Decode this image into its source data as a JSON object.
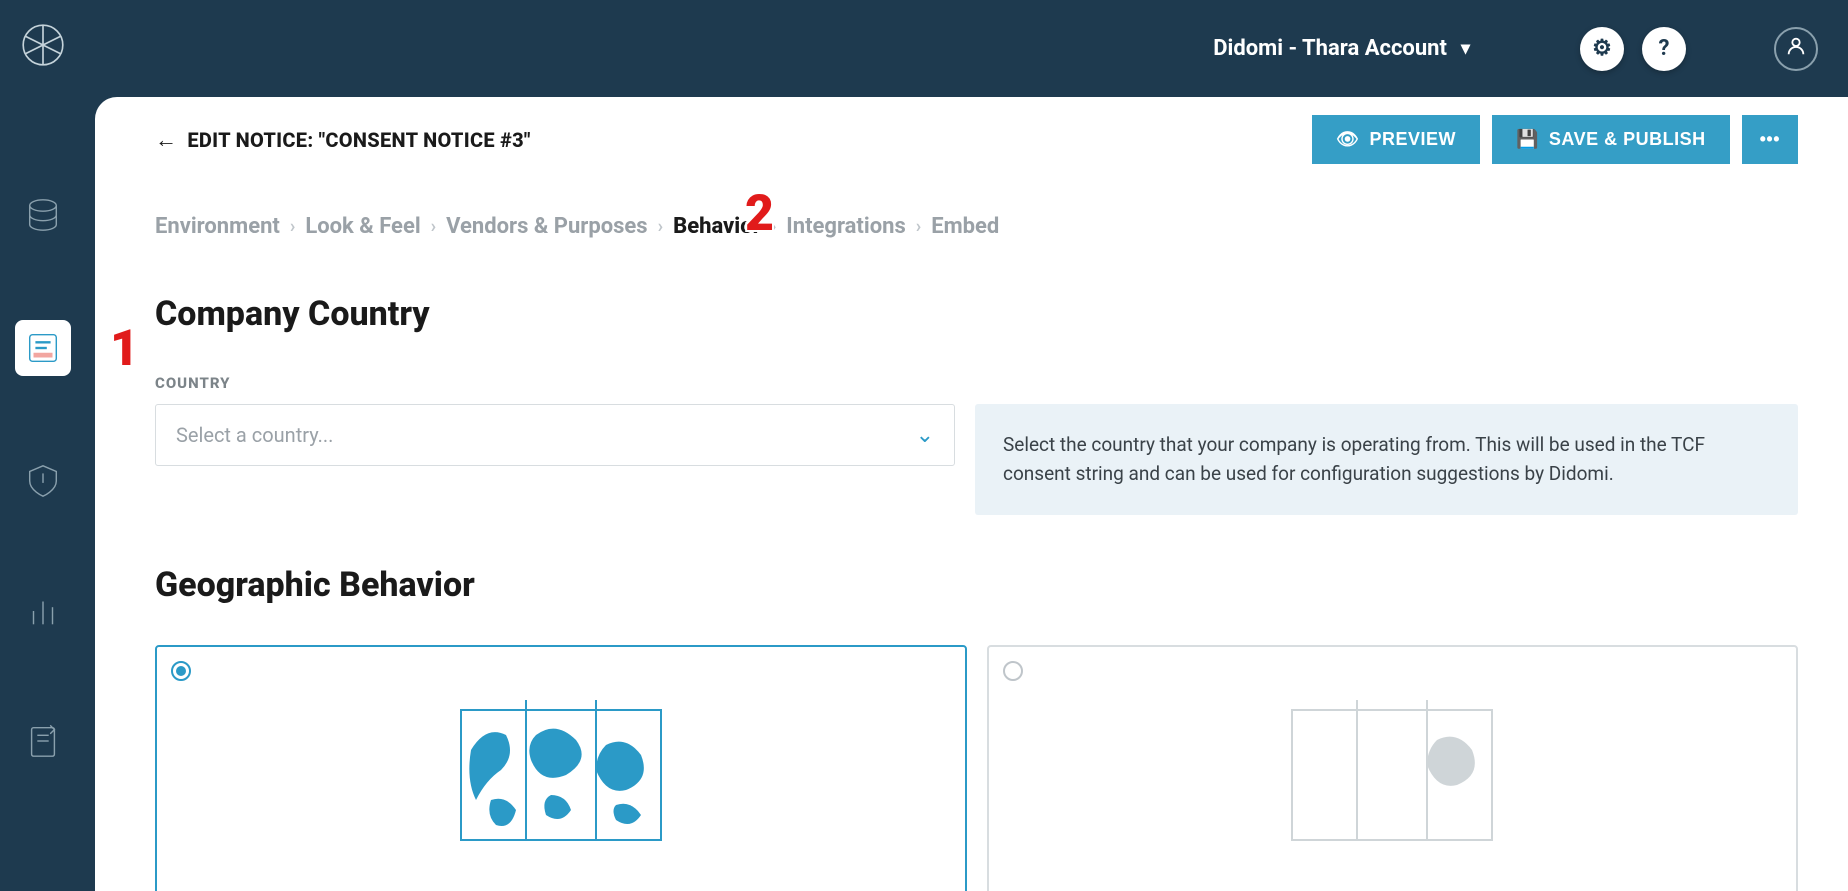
{
  "header": {
    "account_label": "Didomi - Thara Account"
  },
  "page": {
    "back_title": "EDIT NOTICE: \"CONSENT NOTICE #3\"",
    "preview_label": "PREVIEW",
    "save_label": "SAVE & PUBLISH"
  },
  "breadcrumbs": {
    "items": [
      {
        "label": "Environment",
        "active": false
      },
      {
        "label": "Look & Feel",
        "active": false
      },
      {
        "label": "Vendors & Purposes",
        "active": false
      },
      {
        "label": "Behavior",
        "active": true
      },
      {
        "label": "Integrations",
        "active": false
      },
      {
        "label": "Embed",
        "active": false
      }
    ]
  },
  "sections": {
    "company_country_heading": "Company Country",
    "country_label": "COUNTRY",
    "country_placeholder": "Select a country...",
    "country_help": "Select the country that your company is operating from. This will be used in the TCF consent string and can be used for configuration suggestions by Didomi.",
    "geo_heading": "Geographic Behavior"
  },
  "annotations": {
    "one": "1",
    "two": "2"
  }
}
